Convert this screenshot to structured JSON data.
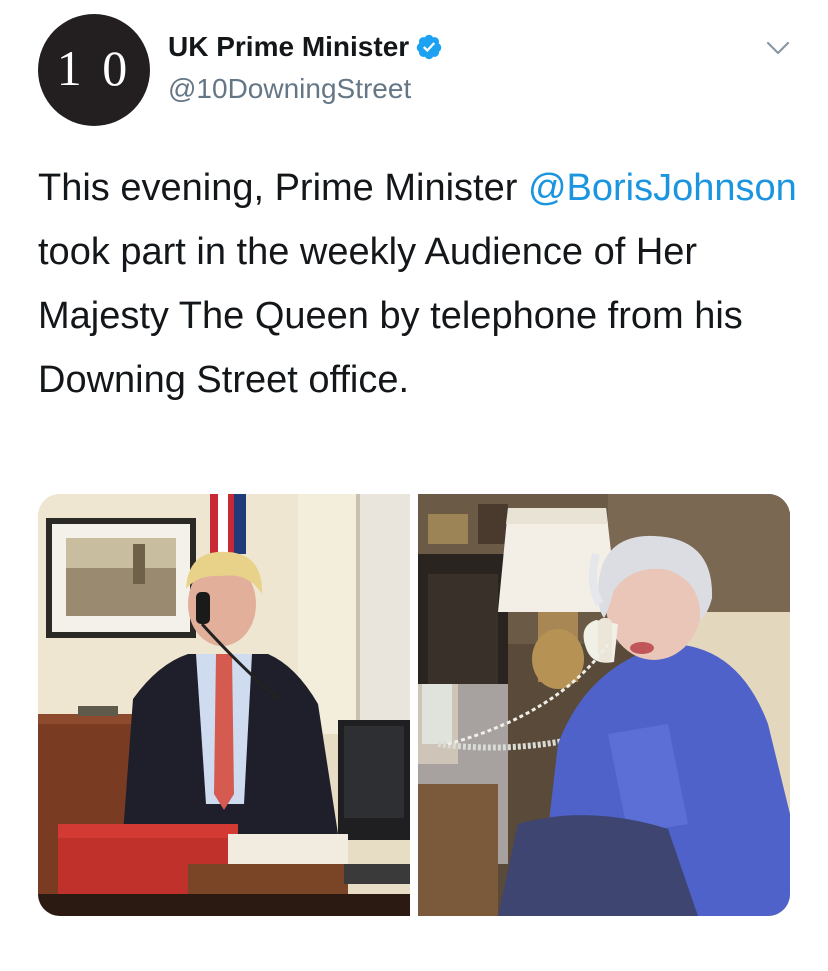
{
  "account": {
    "avatar_text": "1 0",
    "display_name": "UK Prime Minister",
    "handle": "@10DowningStreet",
    "verified": true
  },
  "tweet": {
    "text_before": "This evening, Prime Minister ",
    "mention": "@BorisJohnson",
    "text_after": " took part in the weekly Audience of Her Majesty The Queen by telephone from his Downing Street office."
  },
  "media": {
    "photos": [
      {
        "description_icon": "photo-pm-on-telephone"
      },
      {
        "description_icon": "photo-queen-on-telephone"
      }
    ]
  },
  "colors": {
    "link": "#1b95e0",
    "verified_badge": "#1da1f2",
    "secondary_text": "#657786",
    "avatar_bg": "#231f20"
  }
}
